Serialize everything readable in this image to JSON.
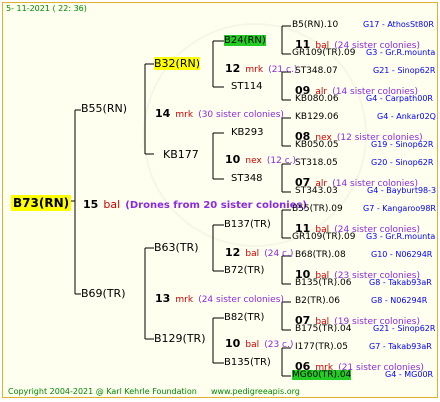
{
  "header": {
    "date": "5- 11-2021 ( 22: 36)"
  },
  "root": {
    "name": "B73(RN)",
    "count": "15",
    "mark": "bal",
    "note": "(Drones from 20 sister colonies)"
  },
  "gen1": [
    {
      "name": "B55(RN)",
      "count": "14",
      "mark": "mrk",
      "note": "(30 sister colonies)"
    },
    {
      "name": "B69(TR)",
      "count": "13",
      "mark": "mrk",
      "note": "(24 sister colonies)"
    }
  ],
  "gen2": [
    {
      "name": "B32(RN)",
      "count": "12",
      "mark": "mrk",
      "note": "(21 c.)"
    },
    {
      "name": "KB177",
      "count": "10",
      "mark": "nex",
      "note": "(12 c.)"
    },
    {
      "name": "B63(TR)",
      "count": "12",
      "mark": "bal",
      "note": "(24 c.)"
    },
    {
      "name": "B129(TR)",
      "count": "10",
      "mark": "bal",
      "note": "(23 c.)"
    }
  ],
  "gen3": [
    {
      "name": "B24(RN)"
    },
    {
      "name": "ST114"
    },
    {
      "name": "KB293"
    },
    {
      "name": "ST348"
    },
    {
      "name": "B137(TR)"
    },
    {
      "name": "B72(TR)"
    },
    {
      "name": "B82(TR)"
    },
    {
      "name": "B135(TR)"
    }
  ],
  "gen4": [
    {
      "top": "B5(RN).10",
      "topinfo": "G17 - AthosSt80R",
      "count": "11",
      "mark": "bal",
      "note": "(24 sister colonies)",
      "bot": "GR109(TR).09",
      "botinfo": "G3 - Gr.R.mounta"
    },
    {
      "top": "ST348.07",
      "topinfo": "G21 - Sinop62R",
      "count": "09",
      "mark": "alr",
      "note": "(14 sister colonies)",
      "bot": "KB080.06",
      "botinfo": "G4 - Carpath00R"
    },
    {
      "top": "KB129.06",
      "topinfo": "G4 - Ankar02Q",
      "count": "08",
      "mark": "nex",
      "note": "(12 sister colonies)",
      "bot": "KB050.05",
      "botinfo": "G19 - Sinop62R"
    },
    {
      "top": "ST318.05",
      "topinfo": "G20 - Sinop62R",
      "count": "07",
      "mark": "alr",
      "note": "(14 sister colonies)",
      "bot": "ST343.03",
      "botinfo": "G4 - Bayburt98-3"
    },
    {
      "top": "B55(TR).09",
      "topinfo": "G7 - Kangaroo98R",
      "count": "11",
      "mark": "bal",
      "note": "(24 sister colonies)",
      "bot": "GR109(TR).09",
      "botinfo": "G3 - Gr.R.mounta"
    },
    {
      "top": "B68(TR).08",
      "topinfo": "G10 - N06294R",
      "count": "10",
      "mark": "bal",
      "note": "(23 sister colonies)",
      "bot": "B135(TR).06",
      "botinfo": "G8 - Takab93aR"
    },
    {
      "top": "B2(TR).06",
      "topinfo": "G8 - N06294R",
      "count": "07",
      "mark": "bal",
      "note": "(19 sister colonies)",
      "bot": "B175(TR).04",
      "botinfo": "G21 - Sinop62R"
    },
    {
      "top": "I177(TR).05",
      "topinfo": "G7 - Takab93aR",
      "count": "06",
      "mark": "mrk",
      "note": "(21 sister colonies)",
      "bot": "MG60(TR).04",
      "botinfo": "G4 - MG00R"
    }
  ],
  "footer": {
    "copyright": "Copyright 2004-2021 @ Karl Kehrle Foundation",
    "url": "www.pedigreeapis.org"
  },
  "colors": {
    "mark": "#cc0000",
    "info": "#0000ff",
    "note": "#8a2be2",
    "footer": "#008800",
    "highlight_yellow": "#ffff00",
    "highlight_green": "#22cc22"
  }
}
